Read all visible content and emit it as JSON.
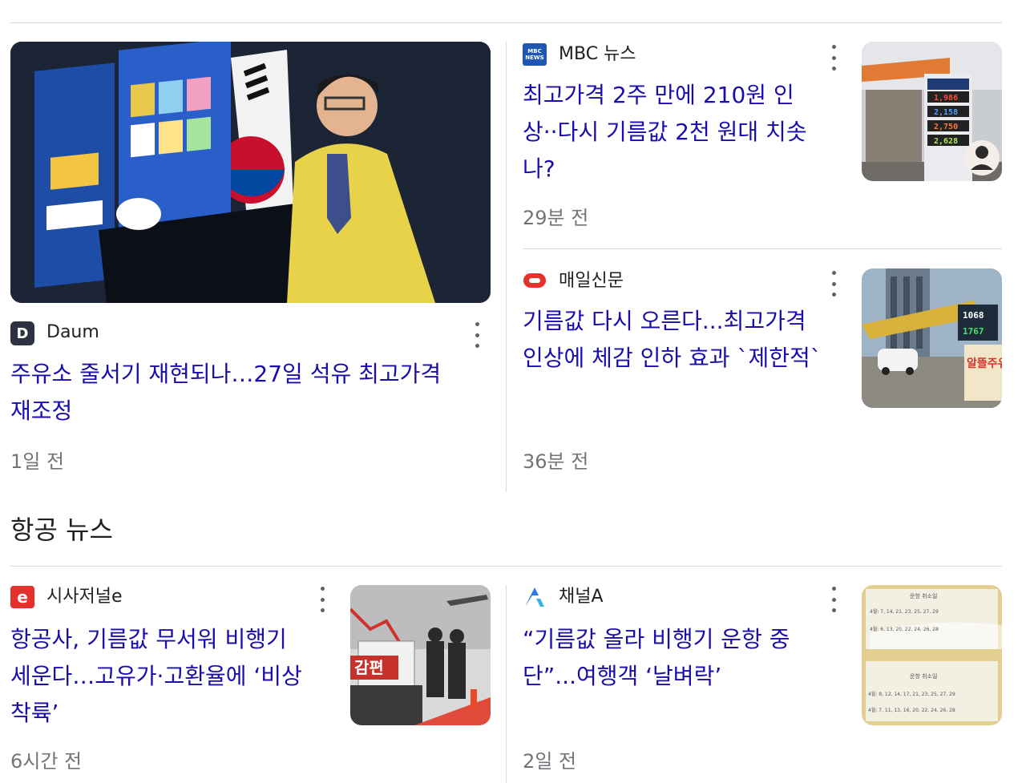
{
  "top_stories": {
    "featured": {
      "source": "Daum",
      "logo_letter": "D",
      "headline_line1": "주유소 줄서기 재현되나…27일 석유 최고가격",
      "headline_line2": "재조정",
      "time": "1일 전"
    },
    "card1": {
      "source": "MBC 뉴스",
      "logo_text": "MBC NEWS",
      "headline_line1": "최고가격 2주 만에 210원 인",
      "headline_line2": "상··다시 기름값 2천 원대 치솟",
      "headline_line3": "나?",
      "time": "29분 전",
      "image_sign_values": [
        "1,986",
        "2,158",
        "2,750",
        "2,628"
      ]
    },
    "card2": {
      "source": "매일신문",
      "headline_line1": "기름값 다시 오른다...최고가격",
      "headline_line2": "인상에 체감 인하 효과 `제한적`",
      "time": "36분 전",
      "image_sign_values": [
        "1068",
        "1767"
      ],
      "image_sign_text": "알뜰주유소"
    }
  },
  "aviation_section": {
    "title": "항공 뉴스",
    "card1": {
      "source": "시사저널e",
      "logo_letter": "e",
      "headline_line1": "항공사, 기름값 무서워 비행기",
      "headline_line2": "세운다…고유가·고환율에 ‘비상",
      "headline_line3": "착륙’",
      "time": "6시간 전",
      "image_text": "감편"
    },
    "card2": {
      "source": "채널A",
      "headline_line1": "“기름값 올라 비행기 운항 중",
      "headline_line2": "단”...여행객 ‘날벼락’",
      "time": "2일 전",
      "image_title1": "운항 취소일",
      "image_row1": "4월: 7, 14, 21, 23, 25, 27, 29",
      "image_row2": "4월: 6, 13, 20, 22, 24, 26, 28",
      "image_title2": "운항 취소일",
      "image_row3": "4월: 8, 12, 14, 17, 21, 23, 25, 27, 29",
      "image_row4": "4월: 7, 11, 13, 16, 20, 22, 24, 26, 28"
    }
  },
  "colors": {
    "headline": "#1a0dab",
    "divider": "#dadce0",
    "muted": "#70757a"
  }
}
